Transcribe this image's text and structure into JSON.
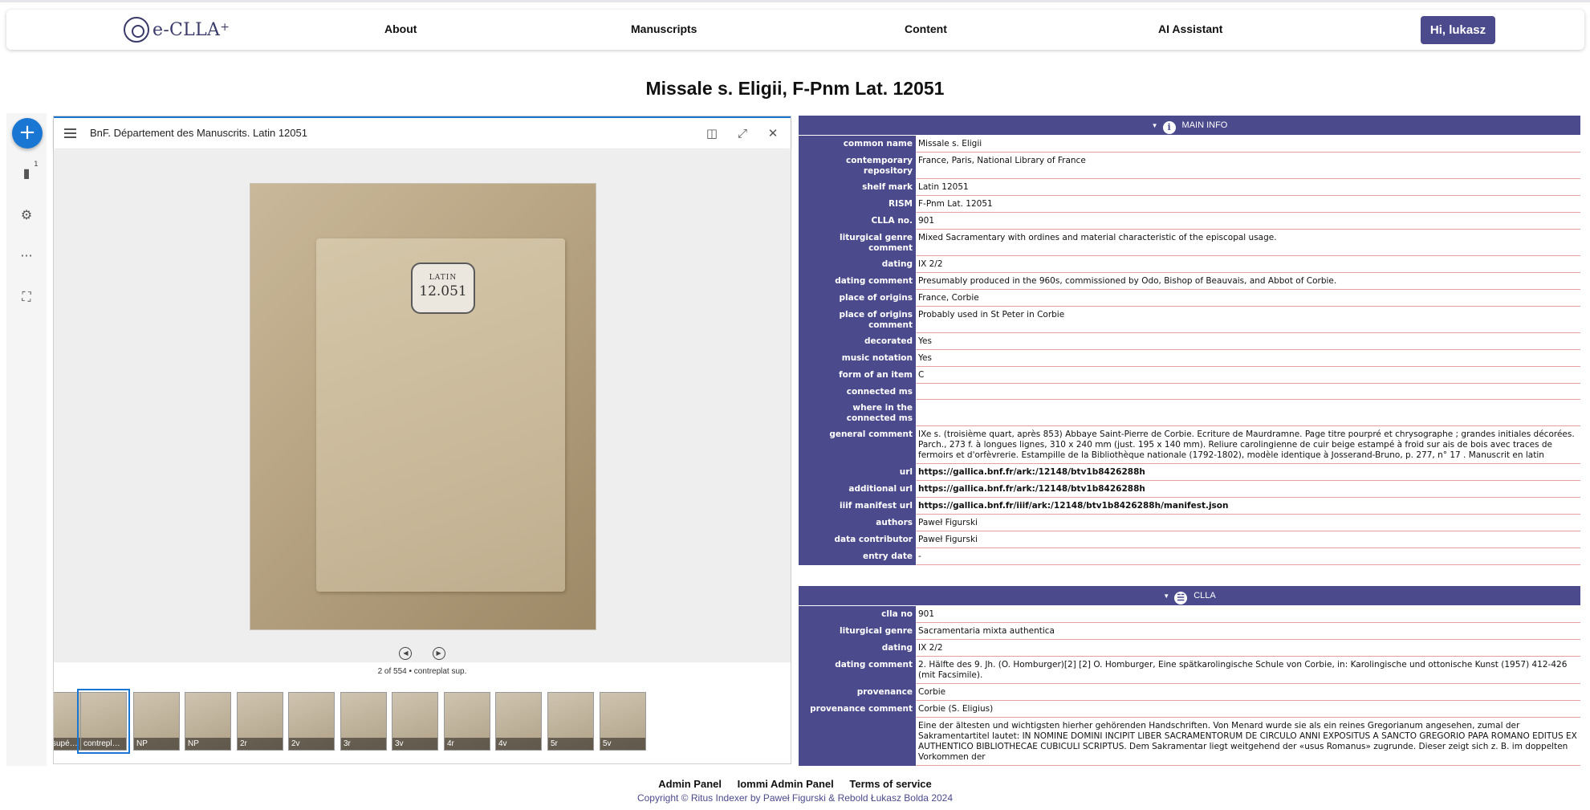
{
  "brand": {
    "name": "e-CLLA",
    "sup": "+"
  },
  "nav": {
    "about": "About",
    "manuscripts": "Manuscripts",
    "content": "Content",
    "ai": "AI Assistant",
    "user": "Hi, lukasz"
  },
  "page_title": "Missale s. Eligii, F-Pnm Lat. 12051",
  "viewer": {
    "window_title": "BnF. Département des Manuscrits. Latin 12051",
    "bookmark_count": "1",
    "page_caption": "2 of 554 • contreplat sup.",
    "label_plate": {
      "line1": "LATIN",
      "line2": "12.051"
    },
    "thumbnails": [
      "supé…",
      "contrepl…",
      "NP",
      "NP",
      "2r",
      "2v",
      "3r",
      "3v",
      "4r",
      "4v",
      "5r",
      "5v"
    ]
  },
  "main_info": {
    "heading": "MAIN INFO",
    "rows": [
      {
        "label": "common name",
        "value": "Missale s. Eligii"
      },
      {
        "label": "contemporary repository",
        "value": "France, Paris, National Library of France"
      },
      {
        "label": "shelf mark",
        "value": "Latin 12051"
      },
      {
        "label": "RISM",
        "value": "F-Pnm Lat. 12051"
      },
      {
        "label": "CLLA no.",
        "value": "901"
      },
      {
        "label": "liturgical genre comment",
        "value": "Mixed Sacramentary with ordines and material characteristic of the episcopal usage."
      },
      {
        "label": "dating",
        "value": "IX 2/2"
      },
      {
        "label": "dating comment",
        "value": "Presumably produced in the 960s, commissioned by Odo, Bishop of Beauvais, and Abbot of Corbie."
      },
      {
        "label": "place of origins",
        "value": "France, Corbie"
      },
      {
        "label": "place of origins comment",
        "value": "Probably used in St Peter in Corbie"
      },
      {
        "label": "decorated",
        "value": "Yes"
      },
      {
        "label": "music notation",
        "value": "Yes"
      },
      {
        "label": "form of an item",
        "value": "C"
      },
      {
        "label": "connected ms",
        "value": ""
      },
      {
        "label": "where in the connected ms",
        "value": ""
      },
      {
        "label": "general comment",
        "value": "IXe s. (troisième quart, après 853) Abbaye Saint-Pierre de Corbie. Ecriture de Maurdramne. Page titre pourpré et chrysographe ; grandes initiales décorées. Parch., 273 f. à longues lignes, 310 x 240 mm (just. 195 x 140 mm). Reliure carolingienne de cuir beige estampé à froid sur ais de bois avec traces de fermoirs et d'orfèvrerie. Estampille de la Bibliothèque nationale (1792-1802), modèle identique à Josserand-Bruno, p. 277, n° 17 . Manuscrit en latin"
      },
      {
        "label": "url",
        "value": "https://gallica.bnf.fr/ark:/12148/btv1b8426288h",
        "link": true
      },
      {
        "label": "additional url",
        "value": "https://gallica.bnf.fr/ark:/12148/btv1b8426288h",
        "link": true
      },
      {
        "label": "iiif manifest url",
        "value": "https://gallica.bnf.fr/iiif/ark:/12148/btv1b8426288h/manifest.json",
        "link": true
      },
      {
        "label": "authors",
        "value": "Paweł Figurski"
      },
      {
        "label": "data contributor",
        "value": "Paweł Figurski"
      },
      {
        "label": "entry date",
        "value": "-"
      }
    ]
  },
  "clla": {
    "heading": "CLLA",
    "rows": [
      {
        "label": "clla no",
        "value": "901"
      },
      {
        "label": "liturgical genre",
        "value": "Sacramentaria mixta authentica"
      },
      {
        "label": "dating",
        "value": "IX 2/2"
      },
      {
        "label": "dating comment",
        "value": "2. Hälfte des 9. Jh. (O. Homburger)[2]   [2] O. Homburger, Eine spätkarolingische Schule von Corbie, in: Karolingische und ottonische Kunst (1957) 412-426 (mit Facsimile)."
      },
      {
        "label": "provenance",
        "value": "Corbie"
      },
      {
        "label": "provenance comment",
        "value": "Corbie (S. Eligius)"
      },
      {
        "label": "",
        "value": "Eine der ältesten und wichtigsten hierher gehörenden Handschriften. Von Menard wurde sie als ein reines Gregorianum angesehen, zumal der Sakramentartitel lautet:  IN NOMINE DOMINI INCIPIT LIBER SACRAMENTORUM DE CIRCULO ANNI EXPOSITUS A SANCTO GREGORIO PAPA ROMANO EDITUS EX AUTHENTICO BIBLIOTHECAE CUBICULI SCRIPTUS.  Dem Sakramentar liegt weitgehend der «usus Romanus» zugrunde. Dieser zeigt sich z. B. im doppelten Vorkommen der"
      }
    ]
  },
  "footer": {
    "admin": "Admin Panel",
    "iommi": "Iommi Admin Panel",
    "terms": "Terms of service",
    "copyright": "Copyright © Ritus Indexer by Paweł Figurski & Rebold Łukasz Bolda 2024"
  },
  "colors": {
    "accent": "#4b4a8d",
    "viewer_blue": "#1976d2",
    "row_border": "#e6a0a0"
  }
}
